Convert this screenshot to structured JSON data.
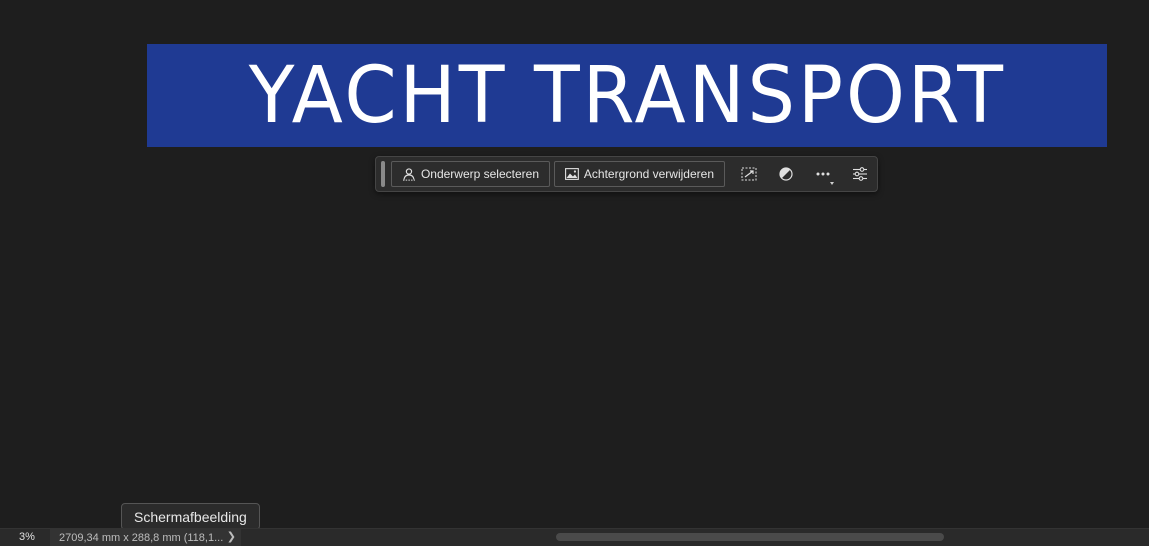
{
  "canvas": {
    "title": "YACHT TRANSPORT",
    "banner_color": "#1f3a93",
    "text_color": "#ffffff"
  },
  "contextual_task_bar": {
    "select_subject_label": "Onderwerp selecteren",
    "remove_background_label": "Achtergrond verwijderen",
    "icons": [
      "select-subject-icon",
      "image-icon",
      "transform-selection-icon",
      "adjustment-circle-icon",
      "more-options-icon",
      "settings-sliders-icon"
    ]
  },
  "status_bar": {
    "zoom": "3%",
    "doc_info": "2709,34 mm x 288,8 mm (118,1...",
    "arrow": "❯"
  },
  "tooltip": {
    "text": "Schermafbeelding"
  }
}
